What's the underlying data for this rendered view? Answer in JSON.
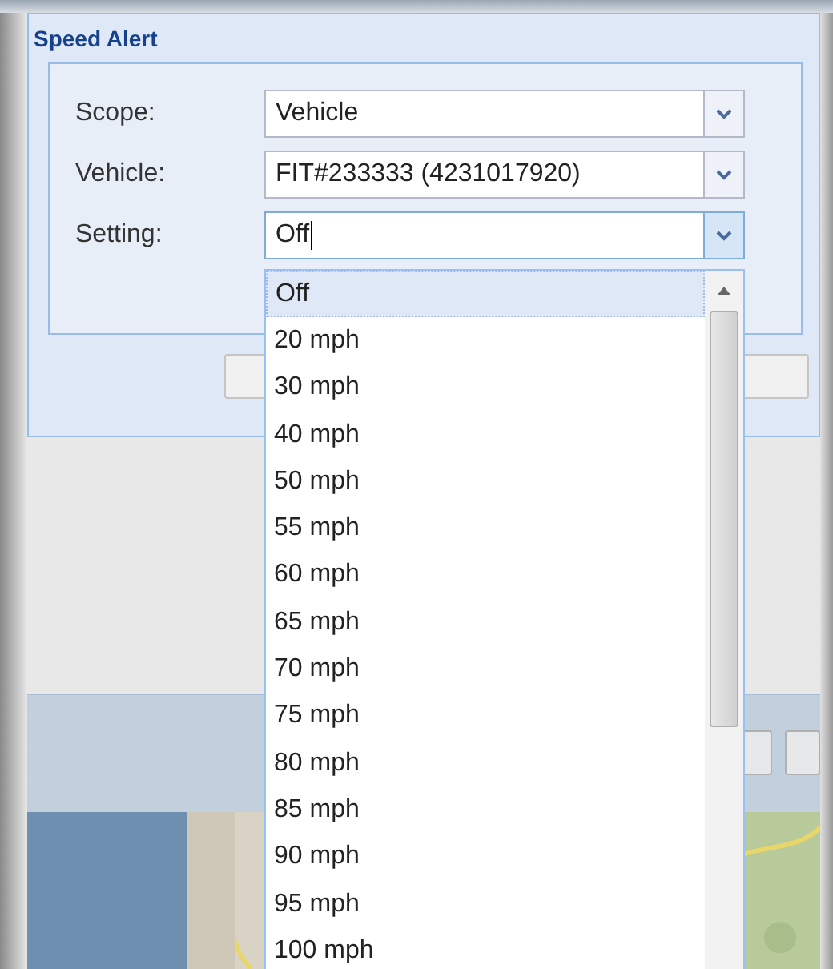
{
  "panel": {
    "title": "Speed Alert"
  },
  "fields": [
    {
      "label": "Scope:",
      "value": "Vehicle",
      "focused": false
    },
    {
      "label": "Vehicle:",
      "value": "FIT#233333 (4231017920)",
      "focused": false
    },
    {
      "label": "Setting:",
      "value": "Off",
      "focused": true
    }
  ],
  "dropdown": {
    "options": [
      {
        "label": "Off",
        "selected": true
      },
      {
        "label": "20 mph",
        "selected": false
      },
      {
        "label": "30 mph",
        "selected": false
      },
      {
        "label": "40 mph",
        "selected": false
      },
      {
        "label": "50 mph",
        "selected": false
      },
      {
        "label": "55 mph",
        "selected": false
      },
      {
        "label": "60 mph",
        "selected": false
      },
      {
        "label": "65 mph",
        "selected": false
      },
      {
        "label": "70 mph",
        "selected": false
      },
      {
        "label": "75 mph",
        "selected": false
      },
      {
        "label": "80 mph",
        "selected": false
      },
      {
        "label": "85 mph",
        "selected": false
      },
      {
        "label": "90 mph",
        "selected": false
      },
      {
        "label": "95 mph",
        "selected": false
      },
      {
        "label": "100 mph",
        "selected": false
      }
    ]
  }
}
